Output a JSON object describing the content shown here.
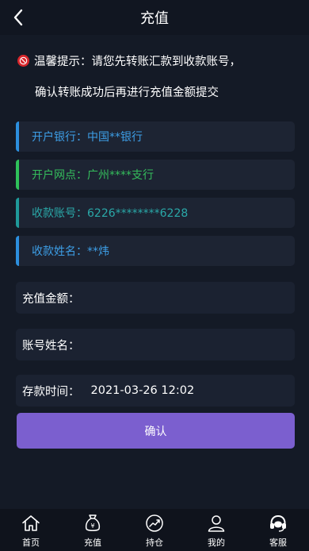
{
  "header": {
    "title": "充值",
    "back_icon": "chevron-left-icon"
  },
  "notice": {
    "icon": "warning-icon",
    "line1": "温馨提示：请您先转账汇款到收款账号，",
    "line2": "确认转账成功后再进行充值金额提交"
  },
  "bank_info": [
    {
      "text": "开户银行：中国**银行",
      "color": "#3d9ee6"
    },
    {
      "text": "开户网点：广州****支行",
      "color": "#35bd5c"
    },
    {
      "text": "收款账号：6226********6228",
      "color": "#2aa8a8"
    },
    {
      "text": "收款姓名：**炜",
      "color": "#3d9ee6"
    }
  ],
  "form": {
    "amount_label": "充值金额：",
    "amount_value": "",
    "name_label": "账号姓名：",
    "name_value": "",
    "time_label": "存款时间：",
    "time_value": "2021-03-26 12:02"
  },
  "confirm_label": "确认",
  "tabbar": [
    {
      "label": "首页",
      "icon": "home-icon"
    },
    {
      "label": "充值",
      "icon": "money-bag-icon"
    },
    {
      "label": "持仓",
      "icon": "chart-icon"
    },
    {
      "label": "我的",
      "icon": "user-icon"
    },
    {
      "label": "客服",
      "icon": "headset-icon"
    }
  ],
  "colors": {
    "accent": "#7b5fcf",
    "background": "#141a26"
  }
}
